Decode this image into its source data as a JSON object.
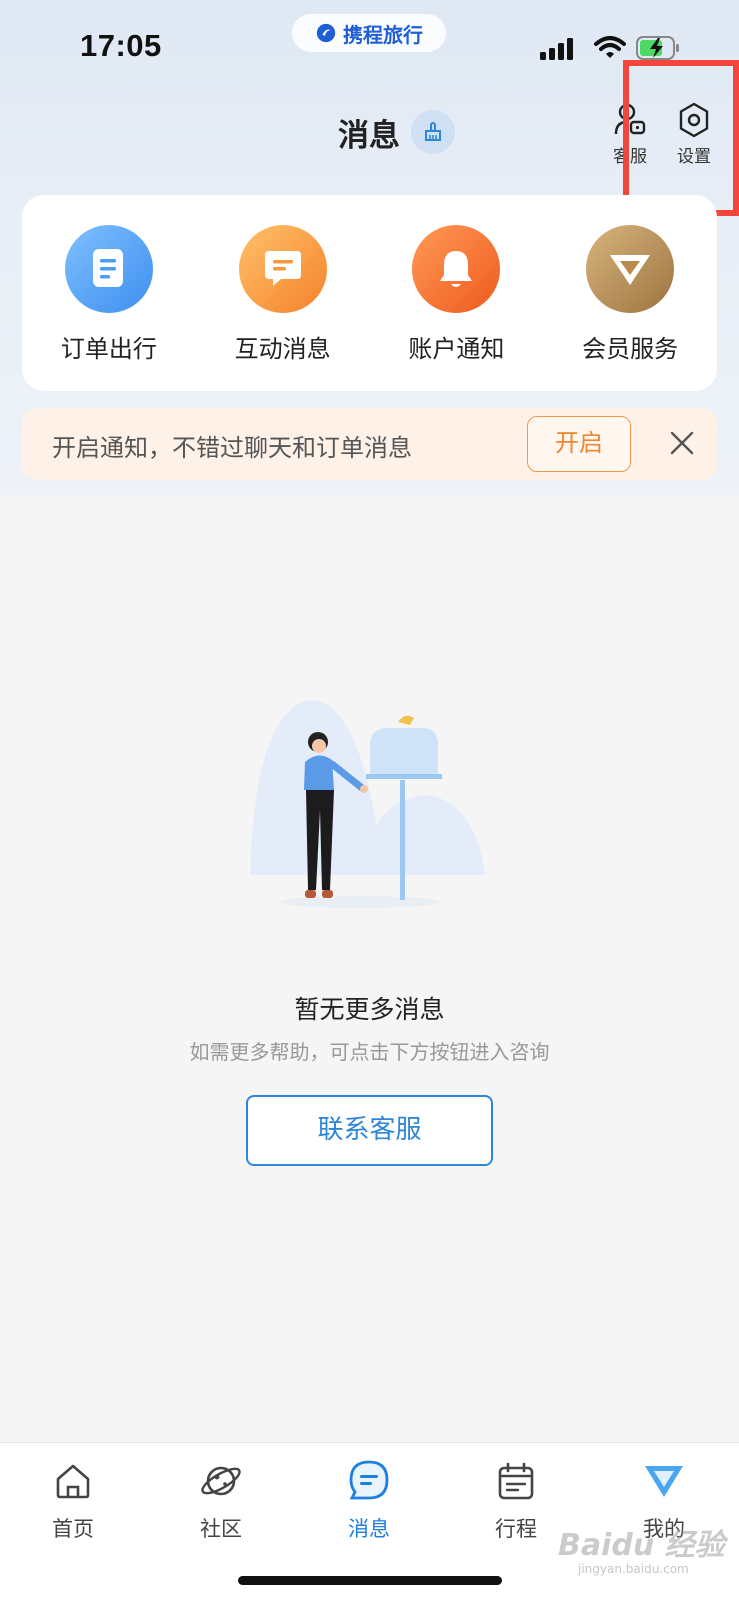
{
  "status_bar": {
    "time": "17:05",
    "brand": "携程旅行"
  },
  "header": {
    "title": "消息",
    "actions": {
      "customer_service": "客服",
      "settings": "设置"
    }
  },
  "quick_actions": [
    {
      "label": "订单出行",
      "icon": "order-icon",
      "color": "#4a9ef5"
    },
    {
      "label": "互动消息",
      "icon": "chat-icon",
      "color": "#f59a3c"
    },
    {
      "label": "账户通知",
      "icon": "bell-icon",
      "color": "#f2712a"
    },
    {
      "label": "会员服务",
      "icon": "vip-diamond-icon",
      "color": "#b88a4e"
    }
  ],
  "notice": {
    "text": "开启通知，不错过聊天和订单消息",
    "button": "开启"
  },
  "empty_state": {
    "title": "暂无更多消息",
    "subtitle": "如需更多帮助，可点击下方按钮进入咨询",
    "button": "联系客服"
  },
  "tabbar": [
    {
      "label": "首页",
      "icon": "home-icon",
      "active": false
    },
    {
      "label": "社区",
      "icon": "planet-icon",
      "active": false
    },
    {
      "label": "消息",
      "icon": "message-icon",
      "active": true
    },
    {
      "label": "行程",
      "icon": "calendar-icon",
      "active": false
    },
    {
      "label": "我的",
      "icon": "vip-icon",
      "active": false
    }
  ],
  "watermark": {
    "text": "Baidu 经验",
    "url": "jingyan.baidu.com"
  },
  "colors": {
    "accent": "#1f7fe0",
    "highlight_box": "#f2463c",
    "notice_accent": "#f0852d"
  }
}
